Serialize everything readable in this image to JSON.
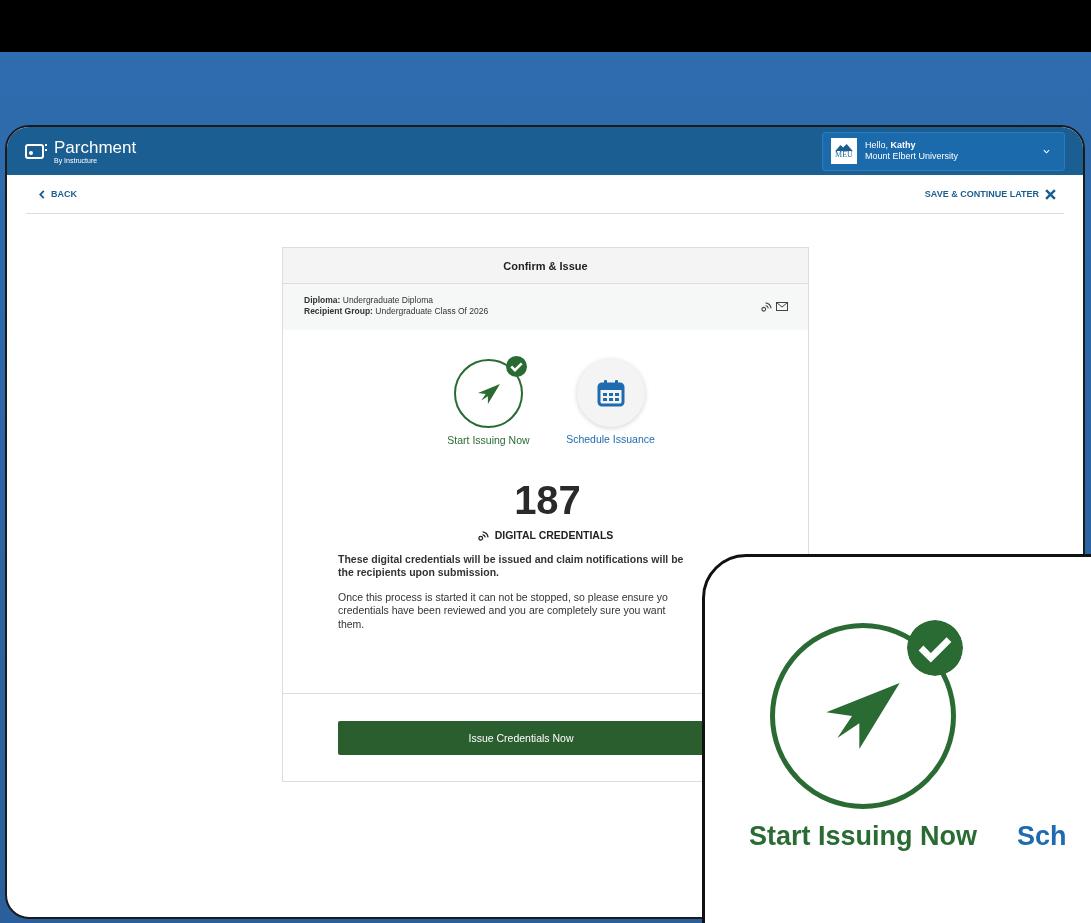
{
  "app": {
    "logo": "Parchment",
    "logo_sub": "By Instructure"
  },
  "user": {
    "org_logo_text": "MEU",
    "greeting": "Hello, **Kathy**",
    "org": "Mount Elbert University"
  },
  "nav": {
    "back": "BACK",
    "save": "SAVE & CONTINUE LATER"
  },
  "card": {
    "title": "Confirm & Issue",
    "details": [
      "**Diploma:** Undergraduate Diploma",
      "**Recipient Group:** Undergraduate Class Of 2026"
    ],
    "options": [
      {
        "label": "Start Issuing Now",
        "kind": "send",
        "selected": true
      },
      {
        "label": "Schedule Issuance",
        "kind": "schedule",
        "selected": false
      }
    ],
    "count": "187",
    "count_label": "DIGITAL CREDENTIALS",
    "notice_lines": [
      "These digital credentials will be issued and claim notifications will be",
      "the recipients upon submission."
    ],
    "warning_lines": [
      "Once this process is started it can not be stopped, so please ensure yo",
      "credentials have been reviewed and you are completely sure you want",
      "them."
    ],
    "submit": "Issue Credentials Now"
  },
  "inset": {
    "options": [
      {
        "label": "Start Issuing Now",
        "kind": "send",
        "selected": true
      },
      {
        "label": "Sch",
        "selected": false
      }
    ]
  }
}
